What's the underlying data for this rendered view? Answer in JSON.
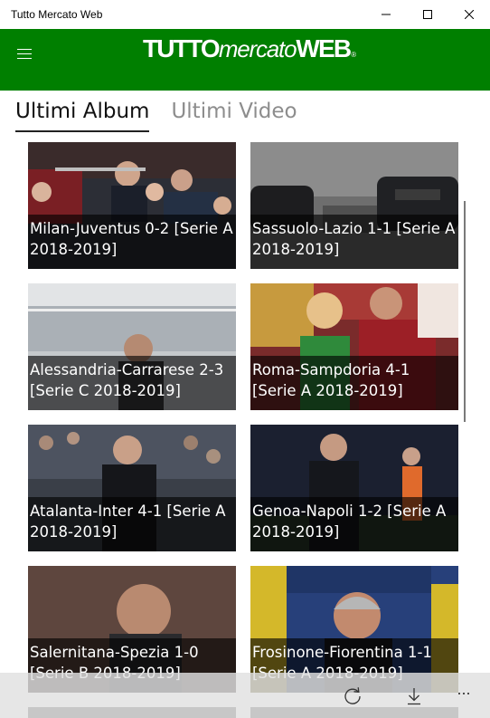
{
  "window": {
    "title": "Tutto Mercato Web"
  },
  "header": {
    "logo_left": "TUTTO",
    "logo_mid": "mercato",
    "logo_right": "WEB",
    "logo_mark": "®",
    "brand_color": "#007f00"
  },
  "tabs": [
    {
      "label": "Ultimi Album",
      "active": true
    },
    {
      "label": "Ultimi Video",
      "active": false
    }
  ],
  "albums": [
    {
      "title": "Milan-Juventus 0-2 [Serie A 2018-2019]"
    },
    {
      "title": "Sassuolo-Lazio 1-1 [Serie A 2018-2019]"
    },
    {
      "title": "Alessandria-Carrarese 2-3 [Serie C 2018-2019]"
    },
    {
      "title": "Roma-Sampdoria 4-1 [Serie A 2018-2019]"
    },
    {
      "title": "Atalanta-Inter 4-1 [Serie A 2018-2019]"
    },
    {
      "title": "Genoa-Napoli 1-2 [Serie A 2018-2019]"
    },
    {
      "title": "Salernitana-Spezia 1-0 [Serie B 2018-2019]"
    },
    {
      "title": "Frosinone-Fiorentina 1-1 [Serie A 2018-2019]"
    }
  ],
  "appbar": {
    "refresh_icon": "refresh-icon",
    "download_icon": "download-icon",
    "more_label": "···"
  }
}
